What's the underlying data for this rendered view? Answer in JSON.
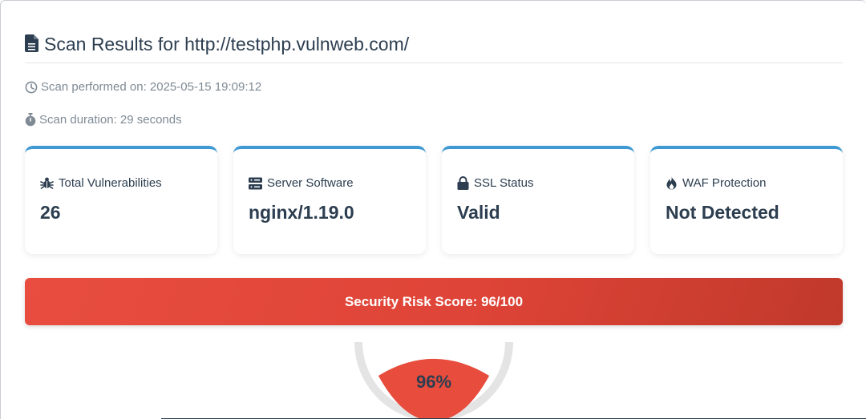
{
  "header": {
    "title": "Scan Results for http://testphp.vulnweb.com/"
  },
  "meta": {
    "performed": "Scan performed on: 2025-05-15 19:09:12",
    "duration": "Scan duration: 29 seconds"
  },
  "cards": [
    {
      "label": "Total Vulnerabilities",
      "value": "26",
      "icon": "bug-icon"
    },
    {
      "label": "Server Software",
      "value": "nginx/1.19.0",
      "icon": "server-icon"
    },
    {
      "label": "SSL Status",
      "value": "Valid",
      "icon": "lock-icon"
    },
    {
      "label": "WAF Protection",
      "value": "Not Detected",
      "icon": "fire-icon"
    }
  ],
  "risk": {
    "label": "Security Risk Score: 96/100",
    "score": 96,
    "percent_text": "96%"
  },
  "colors": {
    "accent": "#3f9ad3",
    "danger": "#e74c3c",
    "danger_dark": "#c0392b",
    "text": "#2c3e50",
    "muted": "#7f8a95"
  }
}
